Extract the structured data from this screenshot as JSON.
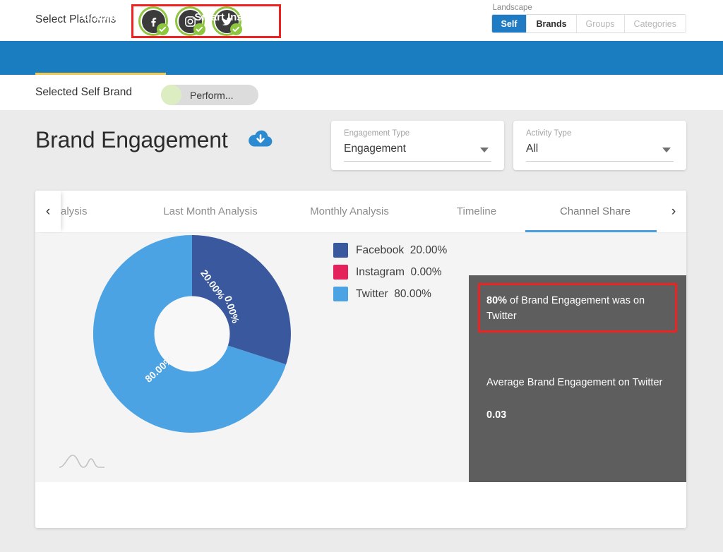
{
  "header": {
    "select_platforms_label": "Select Platforms",
    "platforms": [
      {
        "name": "Facebook",
        "icon": "facebook-icon",
        "selected": true
      },
      {
        "name": "Instagram",
        "icon": "instagram-icon",
        "selected": true
      },
      {
        "name": "Twitter",
        "icon": "twitter-icon",
        "selected": true
      }
    ],
    "landscape": {
      "label": "Landscape",
      "options": [
        {
          "label": "Self",
          "state": "active"
        },
        {
          "label": "Brands",
          "state": "normal"
        },
        {
          "label": "Groups",
          "state": "disabled"
        },
        {
          "label": "Categories",
          "state": "disabled"
        }
      ]
    }
  },
  "nav": {
    "tabs": [
      {
        "label": "Graphs",
        "active": true
      },
      {
        "label": "Smart Insights",
        "active": false
      }
    ]
  },
  "brand_row": {
    "label": "Selected Self Brand",
    "chip_name": "Perform..."
  },
  "main": {
    "title": "Brand Engagement",
    "download_icon": "cloud-download-icon",
    "filters": [
      {
        "label": "Engagement Type",
        "value": "Engagement"
      },
      {
        "label": "Activity Type",
        "value": "All"
      }
    ]
  },
  "card": {
    "prev_arrow": "‹",
    "next_arrow": "›",
    "tabs": [
      {
        "label": "alysis",
        "active": false
      },
      {
        "label": "Last Month Analysis",
        "active": false
      },
      {
        "label": "Monthly Analysis",
        "active": false
      },
      {
        "label": "Timeline",
        "active": false
      },
      {
        "label": "Channel Share",
        "active": true
      }
    ]
  },
  "info_panel": {
    "callout_strong": "80%",
    "callout_rest": " of Brand Engagement was on Twitter",
    "average_label": "Average Brand Engagement on Twitter",
    "average_value": "0.03"
  },
  "colors": {
    "facebook": "#39589e",
    "instagram": "#e5215c",
    "twitter": "#4ba3e3",
    "nav_blue": "#1a7dc0",
    "accent_yellow": "#f2c94c",
    "active_tab_blue": "#4a9fe0",
    "highlight_red": "#ef2222",
    "panel_gray": "#5e5e5e",
    "check_green": "#8dc63f"
  },
  "chart_data": {
    "type": "pie",
    "title": "Channel Share",
    "donut": true,
    "inner_radius_ratio": 0.38,
    "start_angle_deg": 0,
    "categories": [
      "Facebook",
      "Instagram",
      "Twitter"
    ],
    "values": [
      20.0,
      0.0,
      80.0
    ],
    "value_unit": "%",
    "data_labels": [
      "20.00%",
      "0.00%",
      "80.00%"
    ],
    "legend_entries": [
      {
        "label": "Facebook",
        "value": "20.00%",
        "color": "#39589e"
      },
      {
        "label": "Instagram",
        "value": "0.00%",
        "color": "#e5215c"
      },
      {
        "label": "Twitter",
        "value": "80.00%",
        "color": "#4ba3e3"
      }
    ],
    "legend_position": "right",
    "grid": false
  }
}
